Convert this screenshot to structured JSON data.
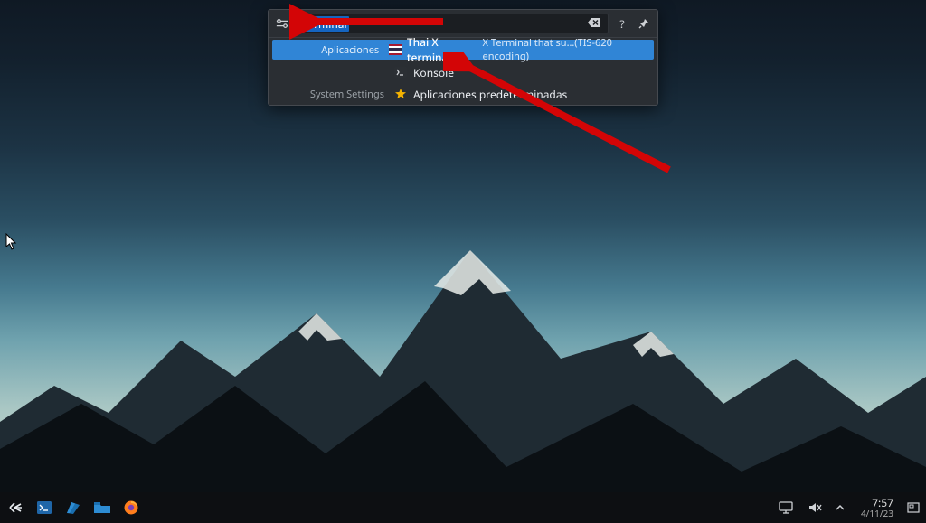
{
  "krunner": {
    "search_value": "terminal",
    "help_glyph": "?",
    "results": [
      {
        "category": "Aplicaciones",
        "title": "Thai X terminal",
        "desc": "X Terminal that su…(TIS-620 encoding)",
        "icon": "thai-flag"
      },
      {
        "category": "",
        "title": "Konsole",
        "desc": "",
        "icon": "terminal"
      },
      {
        "category": "System Settings",
        "title": "Aplicaciones predeterminadas",
        "desc": "",
        "icon": "star"
      }
    ]
  },
  "taskbar": {
    "time": "7:57",
    "date": "4/11/23"
  },
  "colors": {
    "highlight": "#3085d6",
    "panel": "#2a2e33",
    "arrow": "#d30506"
  }
}
